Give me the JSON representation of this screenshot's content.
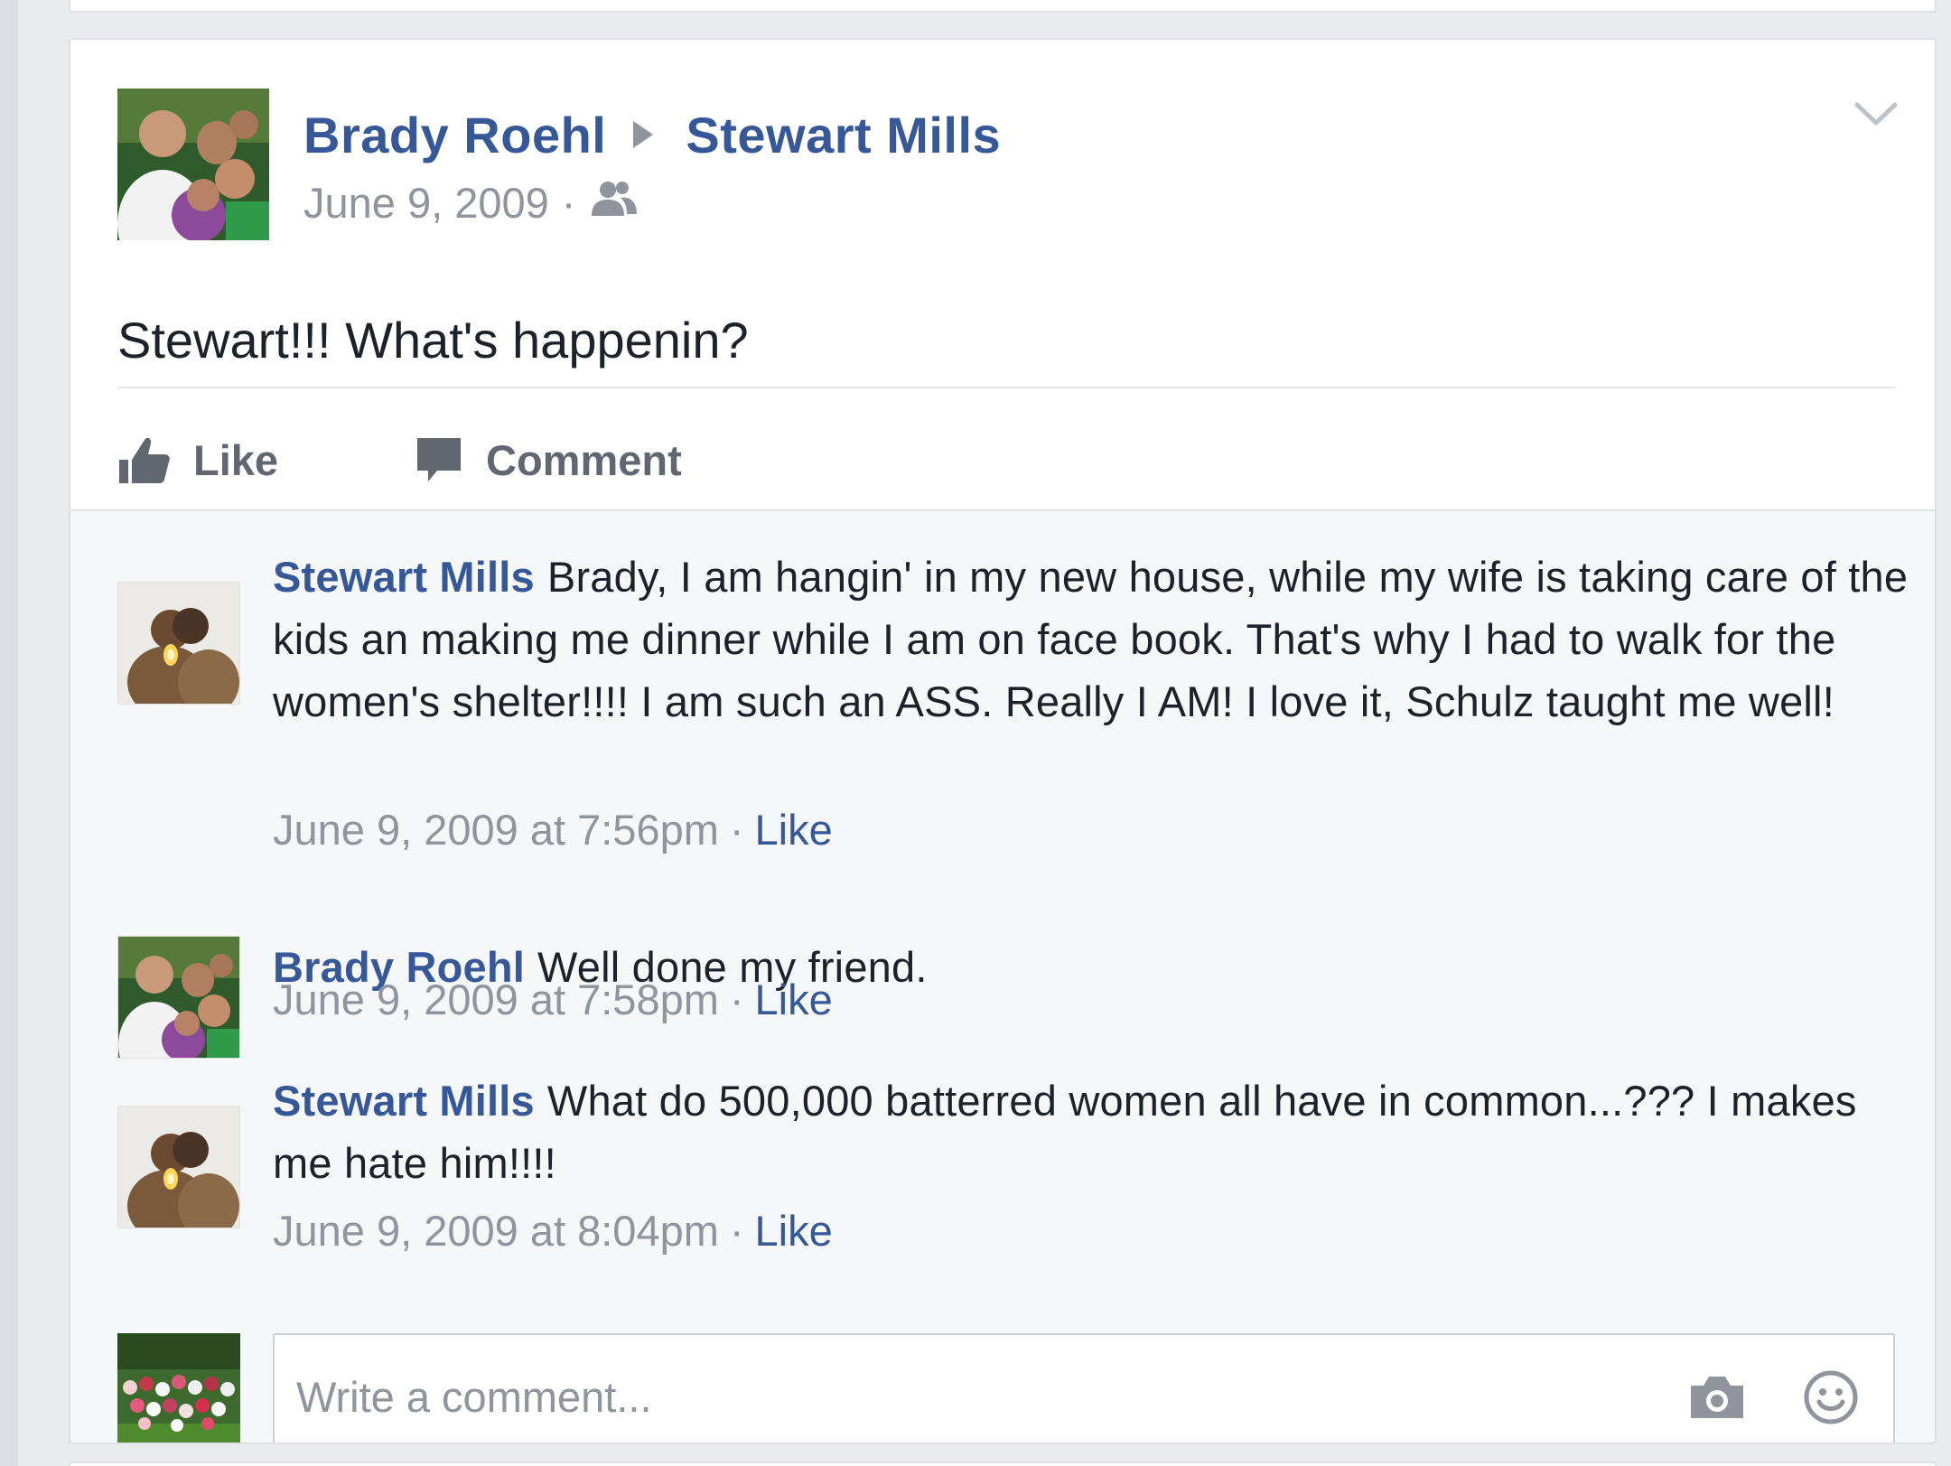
{
  "post": {
    "author": "Brady Roehl",
    "target": "Stewart Mills",
    "date": "June 9, 2009",
    "separator": "·",
    "audience_icon": "friends-icon",
    "text": "Stewart!!! What's happenin?",
    "menu_icon": "chevron-down-icon"
  },
  "actions": {
    "like_label": "Like",
    "comment_label": "Comment"
  },
  "comments": [
    {
      "author": "Stewart Mills",
      "text": "Brady, I am hangin' in my new house, while my wife is taking care of the kids an making me dinner while I am on face book. That's why I had to walk for the women's shelter!!!! I am such an ASS. Really I AM! I love it, Schulz taught me well!",
      "timestamp": "June 9, 2009 at 7:56pm",
      "separator": "·",
      "like_label": "Like"
    },
    {
      "author": "Brady Roehl",
      "text": "Well done my friend.",
      "timestamp": "June 9, 2009 at 7:58pm",
      "separator": "·",
      "like_label": "Like"
    },
    {
      "author": "Stewart Mills",
      "text": "What do 500,000 batterred women all have in common...??? I makes me hate him!!!!",
      "timestamp": "June 9, 2009 at 8:04pm",
      "separator": "·",
      "like_label": "Like"
    }
  ],
  "composer": {
    "placeholder": "Write a comment...",
    "value": "",
    "icons": [
      "camera-icon",
      "smiley-icon"
    ]
  },
  "colors": {
    "link": "#365899",
    "meta": "#90949c",
    "text": "#1d2129",
    "comments_bg": "#f5f7f9"
  }
}
